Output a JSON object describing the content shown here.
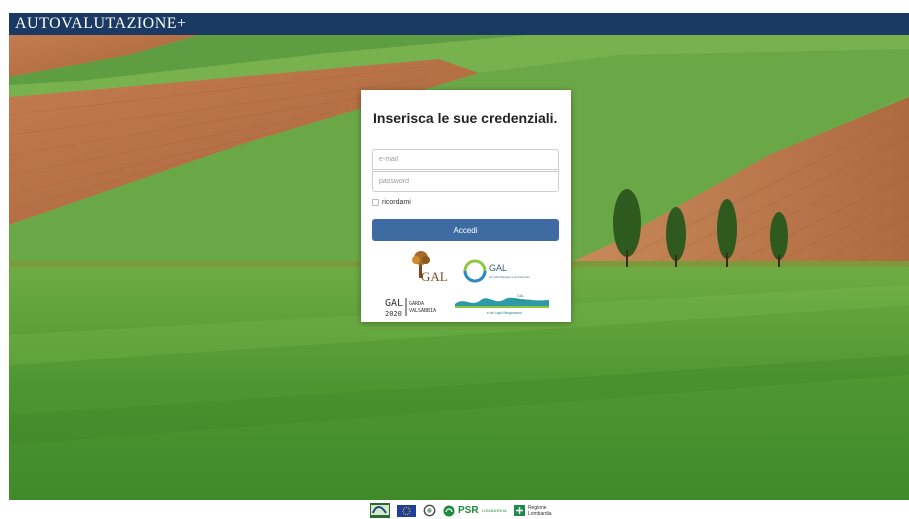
{
  "header": {
    "title": "AUTOVALUTAZIONE+"
  },
  "login": {
    "title": "Inserisca le sue credenziali.",
    "email_placeholder": "e-mail",
    "password_placeholder": "password",
    "remember_label": "ricordami",
    "submit_label": "Accedi"
  },
  "partner_logos": [
    {
      "name": "gal-tree-logo",
      "text": "GAL"
    },
    {
      "name": "gal-colli-logo",
      "text": "GAL",
      "subtext": "dei Colli di Bergamo e del Canto Alto"
    },
    {
      "name": "gal-garda-logo",
      "text_main": "GAL",
      "text_year": "2020",
      "text_side_1": "GARDA",
      "text_side_2": "VALSABBIA"
    },
    {
      "name": "gal-valle-seriana-logo",
      "text_1": "GAL",
      "text_2": "Valle Seriana",
      "text_3": "e dei Laghi Bergamaschi"
    }
  ],
  "footer": {
    "logos": [
      "leader-logo",
      "eu-flag-logo",
      "republic-emblem-logo",
      "psr-logo",
      "regione-lombardia-logo"
    ],
    "psr_text": "PSR",
    "psr_small": "LOMBARDIA",
    "regione_text_1": "Regione",
    "regione_text_2": "Lombardia"
  },
  "colors": {
    "header_bg": "#1b3a63",
    "button_bg": "#3f6ba3",
    "field_green": "#5b9a3a",
    "soil_brown": "#b96d3d"
  }
}
